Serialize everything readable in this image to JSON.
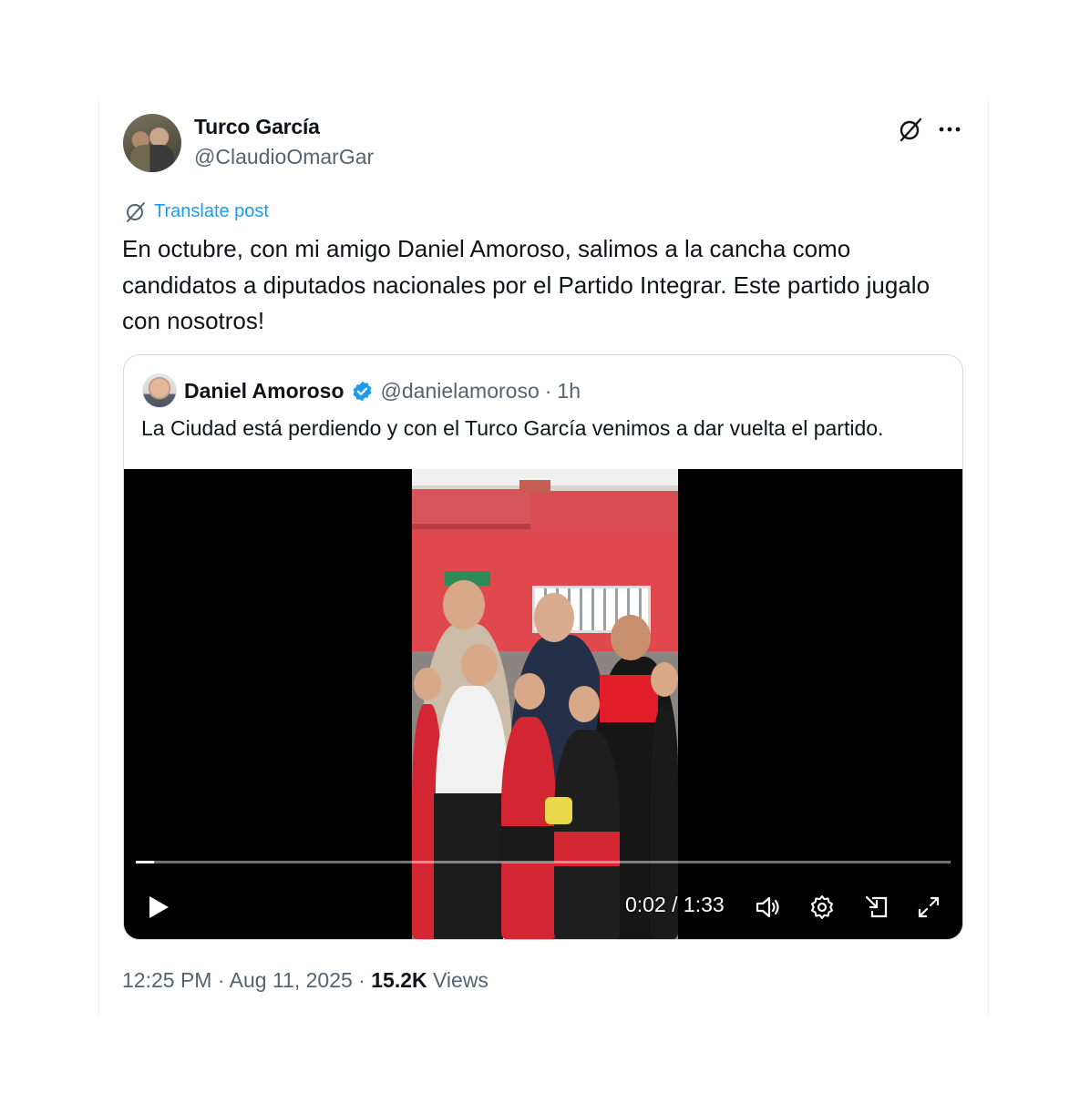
{
  "post": {
    "author_name": "Turco García",
    "author_handle": "@ClaudioOmarGar",
    "translate_label": "Translate post",
    "text": "En octubre, con mi amigo Daniel Amoroso, salimos a la cancha como candidatos a diputados nacionales por el Partido Integrar. Este partido jugalo con nosotros!",
    "icons": {
      "grok": "grok-icon",
      "more": "more-icon",
      "translate": "translate-icon"
    }
  },
  "quote": {
    "author_name": "Daniel Amoroso",
    "author_handle": "@danielamoroso",
    "separator": "·",
    "time": "1h",
    "verified": true,
    "text": "La Ciudad está perdiendo y con el Turco García venimos a dar vuelta el partido.",
    "video": {
      "current_time": "0:02",
      "duration": "1:33",
      "time_display": "0:02 / 1:33",
      "progress": 0.022,
      "icons": [
        "play-icon",
        "volume-icon",
        "settings-icon",
        "pip-icon",
        "fullscreen-icon"
      ]
    }
  },
  "meta": {
    "time": "12:25 PM",
    "sep1": "·",
    "date": "Aug 11, 2025",
    "sep2": "·",
    "views_count": "15.2K",
    "views_label": "Views"
  },
  "colors": {
    "text": "#0f1419",
    "secondary": "#536471",
    "accent": "#1d9bf0",
    "border": "#cfd9de"
  }
}
